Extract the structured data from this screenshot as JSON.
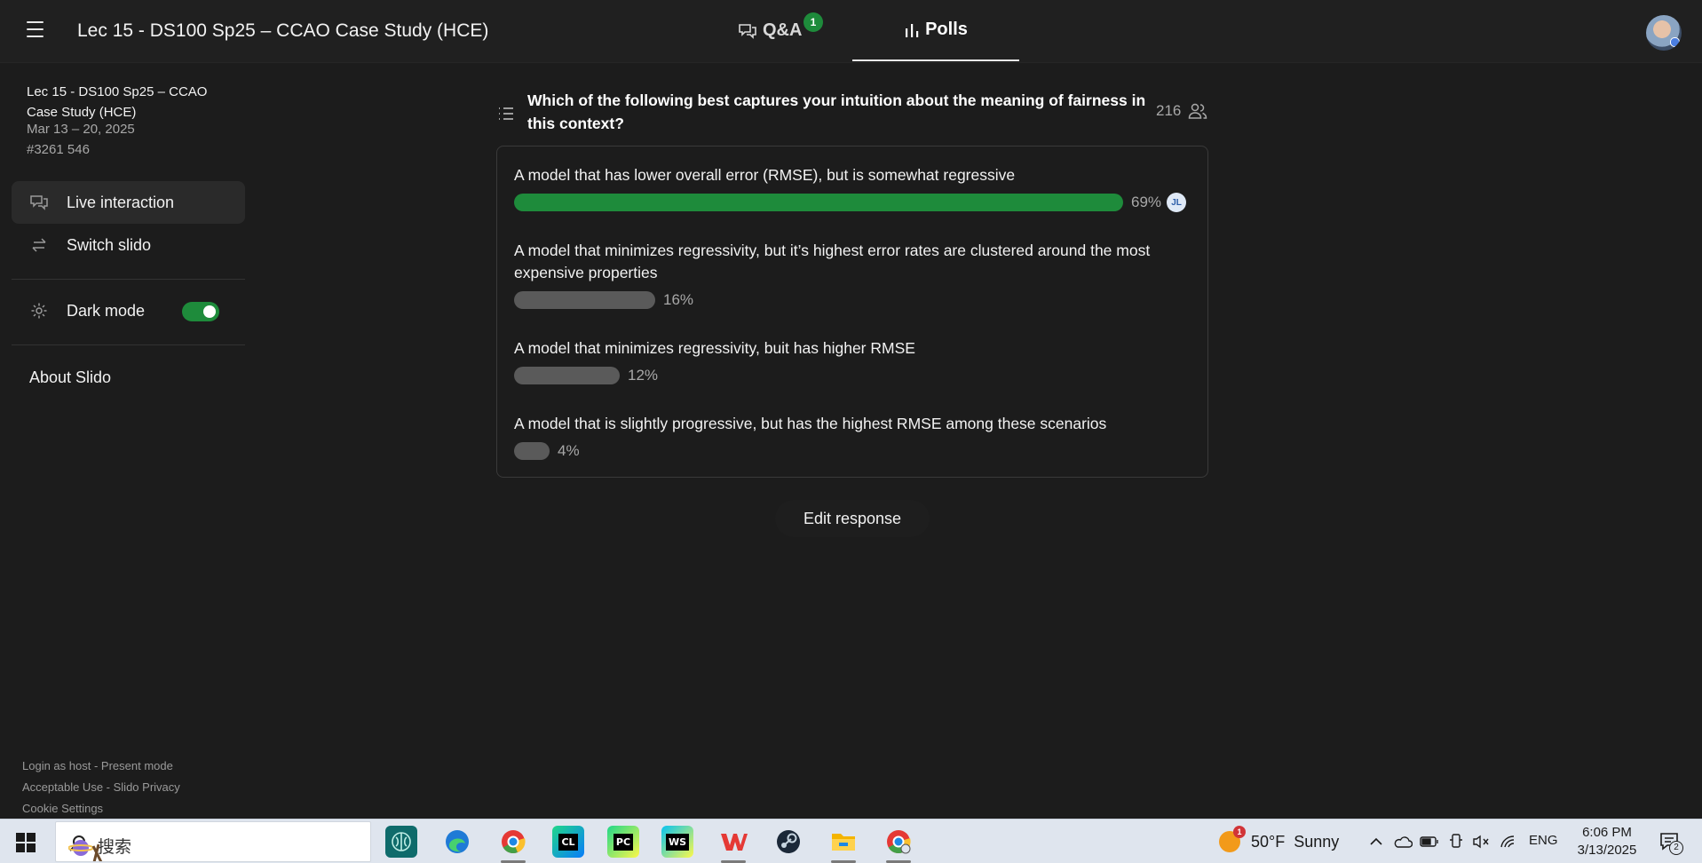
{
  "header": {
    "title": "Lec 15 - DS100 Sp25 – CCAO Case Study (HCE)",
    "tabs": [
      {
        "label": "Q&A",
        "badge": "1"
      },
      {
        "label": "Polls"
      }
    ]
  },
  "sidebar": {
    "event_name": "Lec 15 - DS100 Sp25 – CCAO Case Study (HCE)",
    "event_dates": "Mar 13 – 20, 2025",
    "event_code": "#3261 546",
    "nav": {
      "live": "Live interaction",
      "switch": "Switch slido",
      "dark_mode": "Dark mode",
      "about": "About Slido"
    },
    "dark_mode_on": true,
    "footer": {
      "login": "Login as host",
      "sep": " - ",
      "present": "Present mode",
      "acceptable": "Acceptable Use",
      "privacy": "Slido Privacy",
      "cookie": "Cookie Settings"
    }
  },
  "poll": {
    "question": "Which of the following best captures your intuition about the meaning of fairness in this context?",
    "voters": "216",
    "options": [
      {
        "text": "A model that has lower overall error (RMSE), but is somewhat regressive",
        "percent": 69,
        "label": "69%",
        "voted_by": "JL",
        "leading": true
      },
      {
        "text": "A model that minimizes regressivity, but it’s highest error rates are clustered around the most expensive properties",
        "percent": 16,
        "label": "16%"
      },
      {
        "text": "A model that minimizes regressivity, buit has higher RMSE",
        "percent": 12,
        "label": "12%"
      },
      {
        "text": "A model that is slightly progressive, but has the highest RMSE among these scenarios",
        "percent": 4,
        "label": "4%"
      }
    ],
    "edit_button": "Edit response"
  },
  "colors": {
    "accent_green": "#1e8b3b",
    "bar_gray": "#5a5a5a",
    "background": "#1c1c1c"
  },
  "taskbar": {
    "search_placeholder": "搜索",
    "apps": [
      "brain-app-icon",
      "edge-icon",
      "chrome-icon",
      "clion-icon",
      "pycharm-icon",
      "webstorm-icon",
      "wps-icon",
      "steam-icon",
      "file-explorer-icon",
      "chrome-alt-icon"
    ],
    "weather": {
      "temp": "50°F",
      "condition": "Sunny",
      "badge": "1"
    },
    "language": "ENG",
    "time": "6:06 PM",
    "date": "3/13/2025",
    "notifications": "2"
  }
}
